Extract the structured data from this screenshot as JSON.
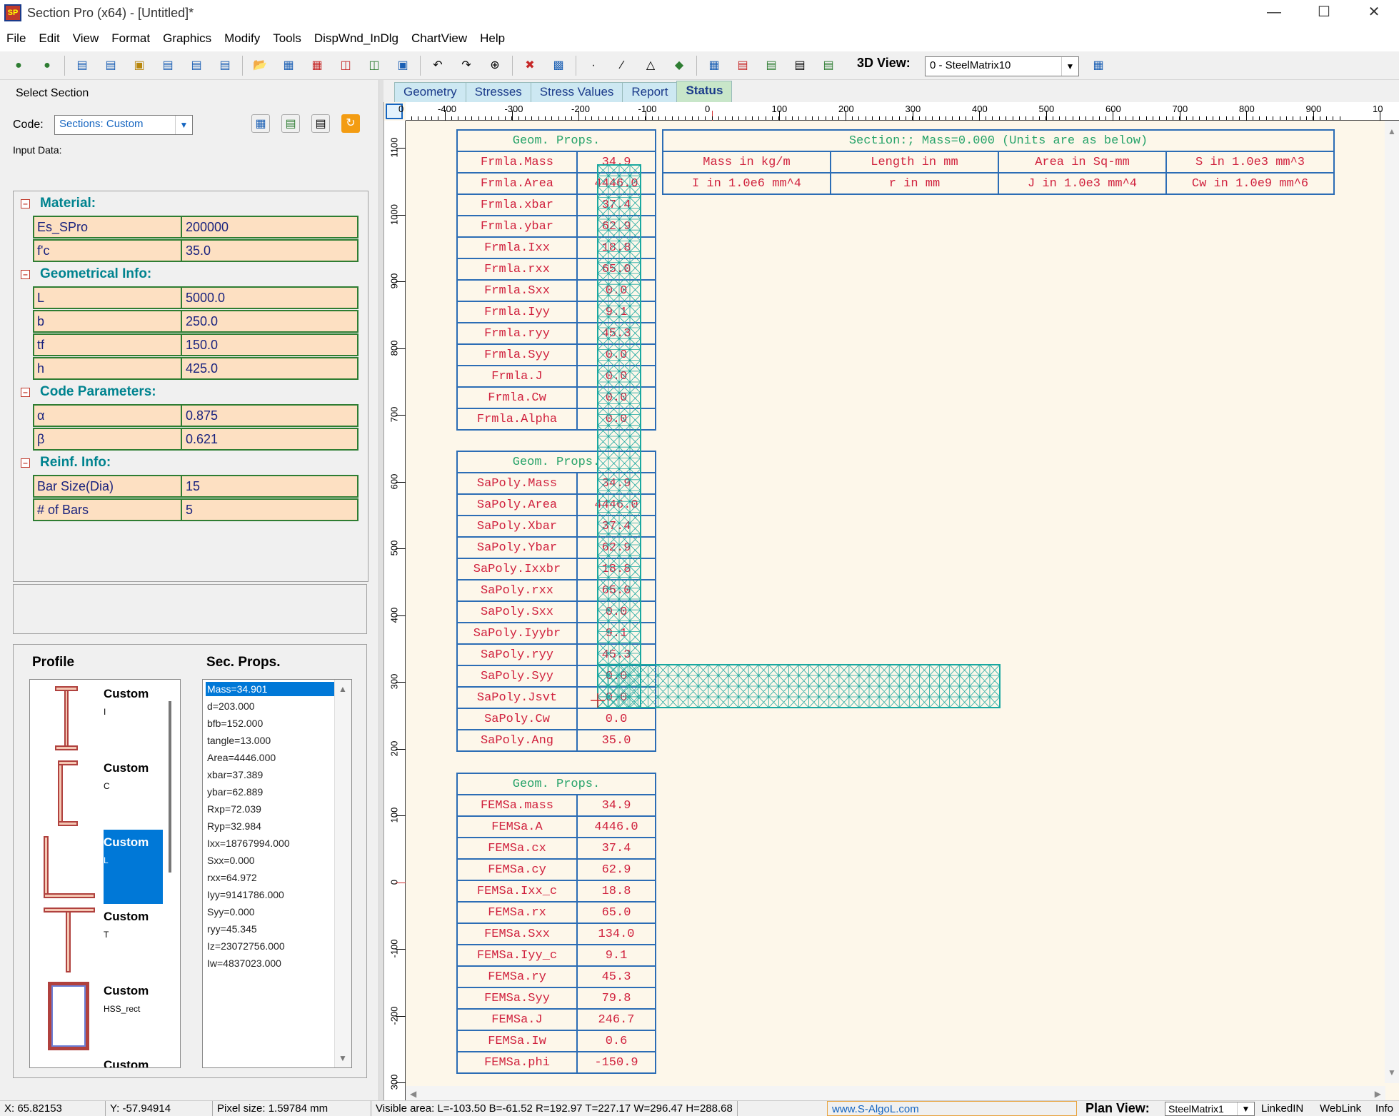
{
  "window": {
    "title": "Section Pro (x64) - [Untitled]*",
    "app_icon": "SP"
  },
  "menu": [
    "File",
    "Edit",
    "View",
    "Format",
    "Graphics",
    "Modify",
    "Tools",
    "DispWnd_InDlg",
    "ChartView",
    "Help"
  ],
  "toolbar": {
    "view3d_label": "3D View:",
    "view3d_value": "0 - SteelMatrix10"
  },
  "left": {
    "select_section": "Select Section",
    "code_label": "Code:",
    "code_value": "Sections: Custom",
    "input_data": "Input Data:",
    "categories": [
      {
        "name": "Material:",
        "rows": [
          {
            "k": "Es_SPro",
            "v": "200000"
          },
          {
            "k": "f'c",
            "v": "35.0"
          }
        ]
      },
      {
        "name": "Geometrical Info:",
        "rows": [
          {
            "k": "L",
            "v": "5000.0"
          },
          {
            "k": "b",
            "v": "250.0"
          },
          {
            "k": "tf",
            "v": "150.0"
          },
          {
            "k": "h",
            "v": "425.0"
          }
        ]
      },
      {
        "name": "Code Parameters:",
        "rows": [
          {
            "k": "α",
            "v": "0.875"
          },
          {
            "k": "β",
            "v": "0.621"
          }
        ]
      },
      {
        "name": "Reinf. Info:",
        "rows": [
          {
            "k": "Bar Size(Dia)",
            "v": "15"
          },
          {
            "k": "# of Bars",
            "v": "5"
          }
        ]
      }
    ],
    "profile_header": "Profile",
    "secprops_header": "Sec. Props.",
    "profiles": [
      {
        "name": "Custom",
        "sub": "I"
      },
      {
        "name": "Custom",
        "sub": "C"
      },
      {
        "name": "Custom",
        "sub": "L"
      },
      {
        "name": "Custom",
        "sub": "T"
      },
      {
        "name": "Custom",
        "sub": "HSS_rect"
      },
      {
        "name": "Custom",
        "sub": ""
      }
    ],
    "sec_props": [
      "Mass=34.901",
      "d=203.000",
      "bfb=152.000",
      "tangle=13.000",
      "Area=4446.000",
      "xbar=37.389",
      "ybar=62.889",
      "Rxp=72.039",
      "Ryp=32.984",
      "Ixx=18767994.000",
      "Sxx=0.000",
      "rxx=64.972",
      "Iyy=9141786.000",
      "Syy=0.000",
      "ryy=45.345",
      "Iz=23072756.000",
      "Iw=4837023.000"
    ]
  },
  "tabs": [
    "Geometry",
    "Stresses",
    "Stress Values",
    "Report",
    "Status"
  ],
  "active_tab": "Status",
  "ruler": {
    "x_ticks": [
      "-400",
      "-300",
      "-200",
      "-100",
      "0",
      "100",
      "200",
      "300",
      "400",
      "500",
      "600",
      "700",
      "800",
      "900",
      "10"
    ],
    "y_ticks": [
      "1100",
      "1000",
      "900",
      "800",
      "700",
      "600",
      "500",
      "400",
      "300",
      "200",
      "100",
      "0",
      "-100",
      "-200",
      "300"
    ],
    "corner": "0"
  },
  "units": {
    "title": "Section:; Mass=0.000 (Units are as below)",
    "row1": [
      "Mass in kg/m",
      "Length in mm",
      "Area in Sq-mm",
      "S in 1.0e3 mm^3"
    ],
    "row2": [
      "I in 1.0e6 mm^4",
      "r in mm",
      "J in 1.0e3 mm^4",
      "Cw in 1.0e9 mm^6"
    ]
  },
  "tables": [
    {
      "header": "Geom. Props.",
      "rows": [
        [
          "Frmla.Mass",
          "34.9"
        ],
        [
          "Frmla.Area",
          "4446.0"
        ],
        [
          "Frmla.xbar",
          "37.4"
        ],
        [
          "Frmla.ybar",
          "62.9"
        ],
        [
          "Frmla.Ixx",
          "18.8"
        ],
        [
          "Frmla.rxx",
          "65.0"
        ],
        [
          "Frmla.Sxx",
          "0.0"
        ],
        [
          "Frmla.Iyy",
          "9.1"
        ],
        [
          "Frmla.ryy",
          "45.3"
        ],
        [
          "Frmla.Syy",
          "0.0"
        ],
        [
          "Frmla.J",
          "0.0"
        ],
        [
          "Frmla.Cw",
          "0.0"
        ],
        [
          "Frmla.Alpha",
          "0.0"
        ]
      ]
    },
    {
      "header": "Geom. Props.",
      "rows": [
        [
          "SaPoly.Mass",
          "34.9"
        ],
        [
          "SaPoly.Area",
          "4446.0"
        ],
        [
          "SaPoly.Xbar",
          "37.4"
        ],
        [
          "SaPoly.Ybar",
          "62.9"
        ],
        [
          "SaPoly.Ixxbr",
          "18.8"
        ],
        [
          "SaPoly.rxx",
          "65.0"
        ],
        [
          "SaPoly.Sxx",
          "0.0"
        ],
        [
          "SaPoly.Iyybr",
          "9.1"
        ],
        [
          "SaPoly.ryy",
          "45.3"
        ],
        [
          "SaPoly.Syy",
          "0.0"
        ],
        [
          "SaPoly.Jsvt",
          "0.0"
        ],
        [
          "SaPoly.Cw",
          "0.0"
        ],
        [
          "SaPoly.Ang",
          "35.0"
        ]
      ]
    },
    {
      "header": "Geom. Props.",
      "rows": [
        [
          "FEMSa.mass",
          "34.9"
        ],
        [
          "FEMSa.A",
          "4446.0"
        ],
        [
          "FEMSa.cx",
          "37.4"
        ],
        [
          "FEMSa.cy",
          "62.9"
        ],
        [
          "FEMSa.Ixx_c",
          "18.8"
        ],
        [
          "FEMSa.rx",
          "65.0"
        ],
        [
          "FEMSa.Sxx",
          "134.0"
        ],
        [
          "FEMSa.Iyy_c",
          "9.1"
        ],
        [
          "FEMSa.ry",
          "45.3"
        ],
        [
          "FEMSa.Syy",
          "79.8"
        ],
        [
          "FEMSa.J",
          "246.7"
        ],
        [
          "FEMSa.Iw",
          "0.6"
        ],
        [
          "FEMSa.phi",
          "-150.9"
        ]
      ]
    }
  ],
  "mesh_color": "#1aa8a0",
  "status": {
    "x": "X: 65.82153",
    "y": "Y: -57.94914",
    "pixel": "Pixel size: 1.59784 mm",
    "visible": "Visible area:  L=-103.50  B=-61.52  R=192.97  T=227.17   W=296.47  H=288.68",
    "link": "www.S-AlgoL.com",
    "plan_label": "Plan View:",
    "plan_value": "SteelMatrix1",
    "btn1": "LinkedIN",
    "btn2": "WebLink",
    "btn3": "Info"
  }
}
